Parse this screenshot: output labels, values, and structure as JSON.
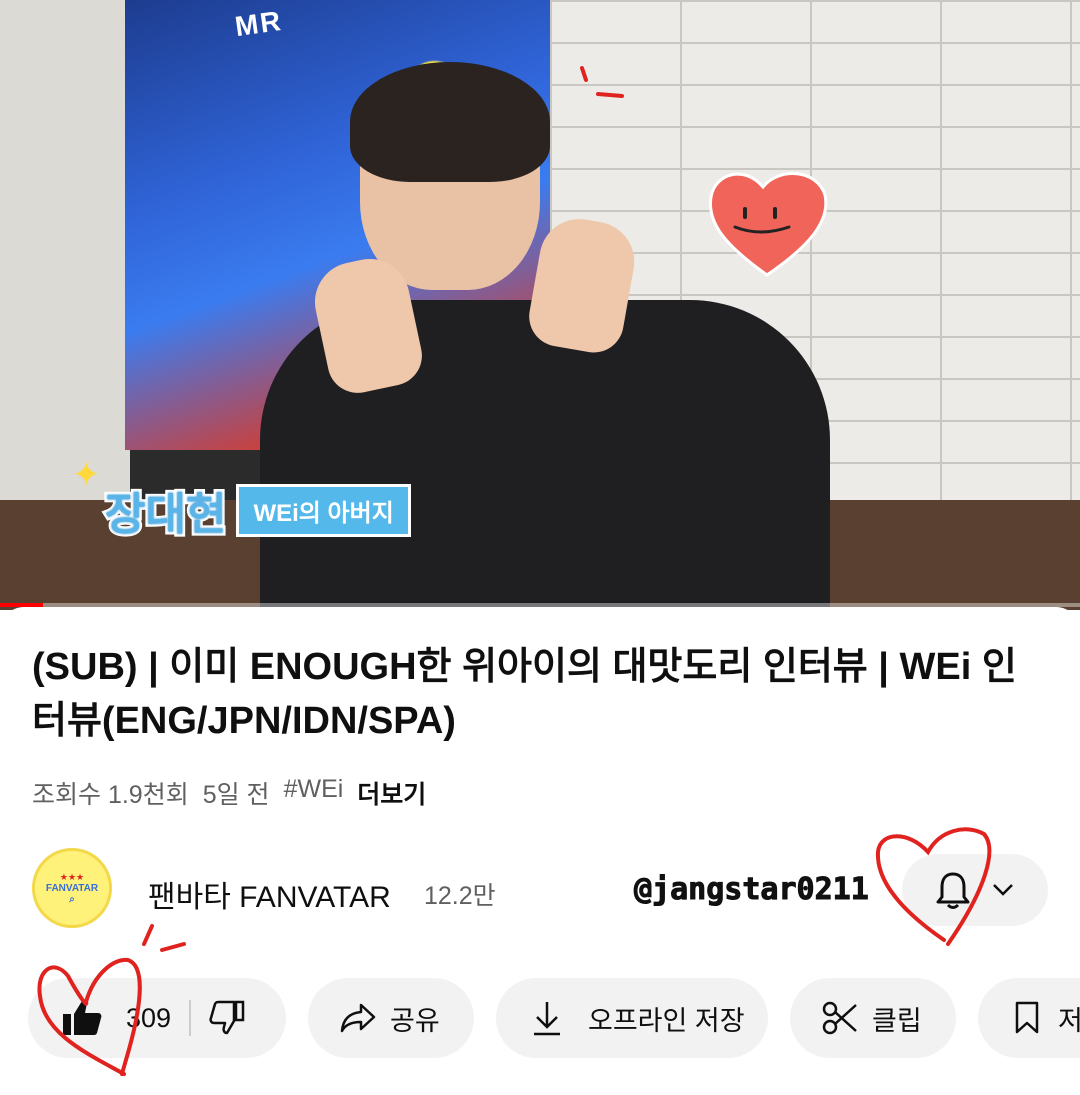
{
  "video": {
    "poster_text": "MR",
    "caption_name": "장대현",
    "caption_role": "WEi의 아버지",
    "progress": 0.04
  },
  "title": "(SUB) | 이미 ENOUGH한 위아이의 대맛도리 인터뷰 | WEi 인터뷰(ENG/JPN/IDN/SPA)",
  "meta": {
    "views": "조회수 1.9천회",
    "age": "5일 전",
    "hashtag": "#WEi",
    "more": "더보기"
  },
  "channel": {
    "avatar_text": "FANVATAR",
    "name": "팬바타 FANVATAR",
    "subscribers": "12.2만",
    "watermark": "@jangstar0211"
  },
  "actions": {
    "like_count": "309",
    "share": "공유",
    "download": "오프라인 저장",
    "clip": "클립",
    "save": "저"
  },
  "colors": {
    "accent_red": "#ff0000",
    "pill_bg": "#f2f2f2",
    "annotation_red": "#e0231f",
    "heart_sticker": "#f0645a"
  }
}
